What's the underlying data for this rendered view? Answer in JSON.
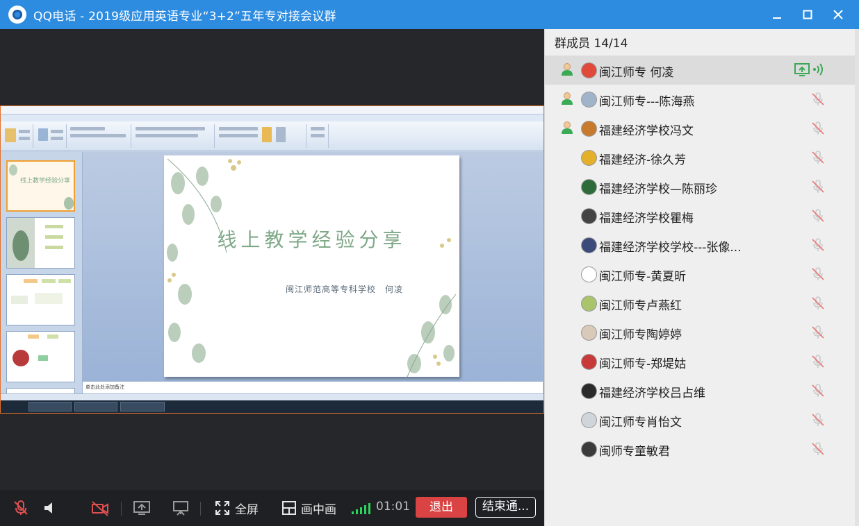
{
  "window": {
    "title": "QQ电话 - 2019级应用英语专业“3+2”五年专对接会议群"
  },
  "presentation": {
    "slide_title": "线上教学经验分享",
    "slide_subtitle": "闽江师范高等专科学校　何凌",
    "notes_placeholder": "单击此处添加备注"
  },
  "toolbar": {
    "fullscreen_label": "全屏",
    "pip_label": "画中画",
    "timer": "01:01",
    "exit_label": "退出",
    "end_label": "结束通..."
  },
  "members": {
    "header": "群成员 14/14",
    "list": [
      {
        "name": "闽江师专 何凌",
        "admin": true,
        "sharing": true,
        "avatar_color": "#e04a3a"
      },
      {
        "name": "闽江师专---陈海燕",
        "admin": true,
        "sharing": false,
        "avatar_color": "#9fb3c9"
      },
      {
        "name": "福建经济学校冯文",
        "admin": true,
        "sharing": false,
        "avatar_color": "#c77a2d"
      },
      {
        "name": "福建经济-徐久芳",
        "admin": false,
        "sharing": false,
        "avatar_color": "#e4b02a"
      },
      {
        "name": "福建经济学校—陈丽珍",
        "admin": false,
        "sharing": false,
        "avatar_color": "#2e6b3a"
      },
      {
        "name": "福建经济学校瞿梅",
        "admin": false,
        "sharing": false,
        "avatar_color": "#444444"
      },
      {
        "name": "福建经济学校学校---张像...",
        "admin": false,
        "sharing": false,
        "avatar_color": "#3a4a7a"
      },
      {
        "name": "闽江师专-黄夏昕",
        "admin": false,
        "sharing": false,
        "avatar_color": "#ffffff"
      },
      {
        "name": "闽江师专卢燕红",
        "admin": false,
        "sharing": false,
        "avatar_color": "#a9c46a"
      },
      {
        "name": "闽江师专陶婷婷",
        "admin": false,
        "sharing": false,
        "avatar_color": "#d9c9b9"
      },
      {
        "name": "闽江师专-郑堤姑",
        "admin": false,
        "sharing": false,
        "avatar_color": "#c83a3a"
      },
      {
        "name": "福建经济学校吕占维",
        "admin": false,
        "sharing": false,
        "avatar_color": "#2a2a2a"
      },
      {
        "name": "闽江师专肖怡文",
        "admin": false,
        "sharing": false,
        "avatar_color": "#cfd5da"
      },
      {
        "name": "闽师专童敏君",
        "admin": false,
        "sharing": false,
        "avatar_color": "#3b3b3b"
      }
    ]
  },
  "colors": {
    "titlebar": "#2d8ce0",
    "exit_button": "#d94343",
    "signal": "#2bd45a",
    "muted_icon": "#e05050"
  }
}
